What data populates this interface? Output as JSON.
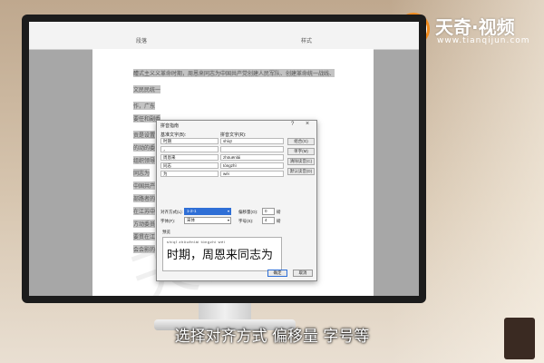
{
  "brand": {
    "badge": "@",
    "name": "天奇·视频",
    "url": "www.tianqijun.com"
  },
  "ribbon": {
    "groups": [
      "段落",
      "样式"
    ]
  },
  "document": {
    "lines": [
      "醴式主义义革命时期，周恩来同志为中国共产党创建人民军队、创建革命统一战线、",
      "文民民统一",
      "作，广东",
      "要任和副委",
      "贡是设置",
      "的动的委",
      "组织领导",
      "同志为",
      "中国共产",
      "部路者的",
      "在江苏中",
      "方动委员",
      "要贯在江",
      "会会影的"
    ]
  },
  "dialog": {
    "title": "拼音指南",
    "help_glyph": "?",
    "close_glyph": "×",
    "base_header": "基准文字(B):",
    "ruby_header": "拼音文字(R):",
    "rows": [
      {
        "base": "时期",
        "ruby": "shíqī"
      },
      {
        "base": "，",
        "ruby": ""
      },
      {
        "base": "周恩来",
        "ruby": "zhōuēnlái"
      },
      {
        "base": "同志",
        "ruby": "tóngzhì"
      },
      {
        "base": "为",
        "ruby": "wèi"
      }
    ],
    "side_buttons": [
      "组合(G)",
      "单字(M)",
      "清除读音(C)",
      "默认读音(D)"
    ],
    "align_label": "对齐方式(L):",
    "align_value": "1-2-1",
    "offset_label": "偏移量(O):",
    "offset_value": "0",
    "font_label": "字体(F):",
    "font_value": "宋体",
    "size_label": "字号(S):",
    "size_value": "4",
    "unit": "磅",
    "preview_label": "预览",
    "preview_pinyin": "shíqī  zhōuēnlái tóngzhì wèi",
    "preview_text": "时期，周恩来同志为",
    "ok_label": "确定",
    "cancel_label": "取消"
  },
  "subtitle": "选择对齐方式 偏移量 字号等"
}
